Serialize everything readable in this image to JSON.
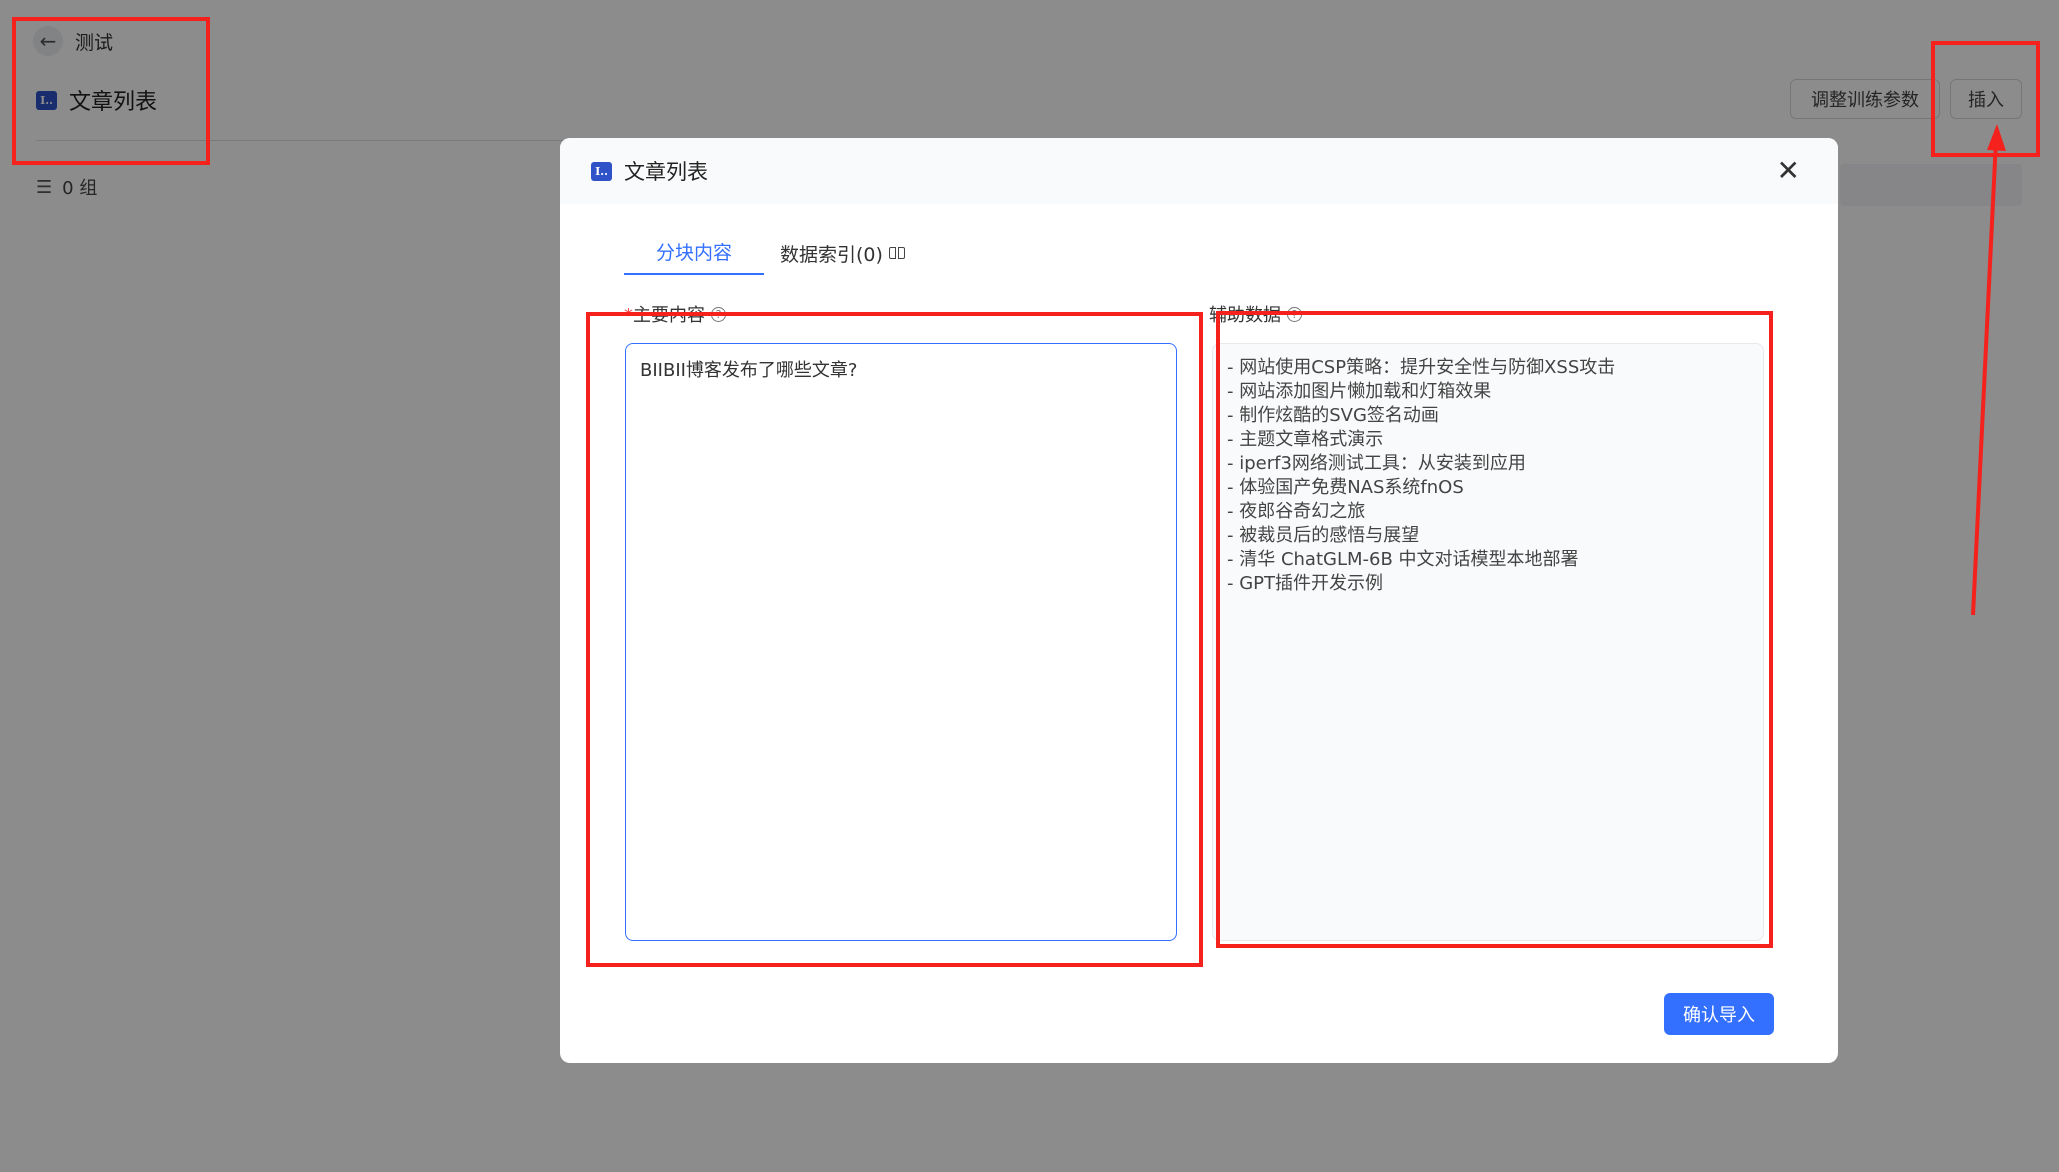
{
  "background": {
    "back_label": "测试",
    "title": "文章列表",
    "app_icon_text": "I..",
    "count_label": "0 组",
    "buttons": {
      "adjust": "调整训练参数",
      "insert": "插入"
    }
  },
  "modal": {
    "title": "文章列表",
    "app_icon_text": "I..",
    "close": "✕",
    "tabs": [
      {
        "label": "分块内容"
      },
      {
        "label": "数据索引(0)"
      }
    ],
    "main_label": "主要内容",
    "required_mark": "*",
    "aux_label": "辅助数据",
    "main_value": "BIIBII博客发布了哪些文章?",
    "aux_lines": [
      "- 网站使用CSP策略：提升安全性与防御XSS攻击",
      "- 网站添加图片懒加载和灯箱效果",
      "- 制作炫酷的SVG签名动画",
      "- 主题文章格式演示",
      "- iperf3网络测试工具：从安装到应用",
      "- 体验国产免费NAS系统fnOS",
      "- 夜郎谷奇幻之旅",
      "- 被裁员后的感悟与展望",
      "- 清华 ChatGLM-6B 中文对话模型本地部署",
      "- GPT插件开发示例"
    ],
    "confirm_button": "确认导入"
  },
  "colors": {
    "accent": "#3370ff",
    "annotation_red": "#f5211c"
  }
}
